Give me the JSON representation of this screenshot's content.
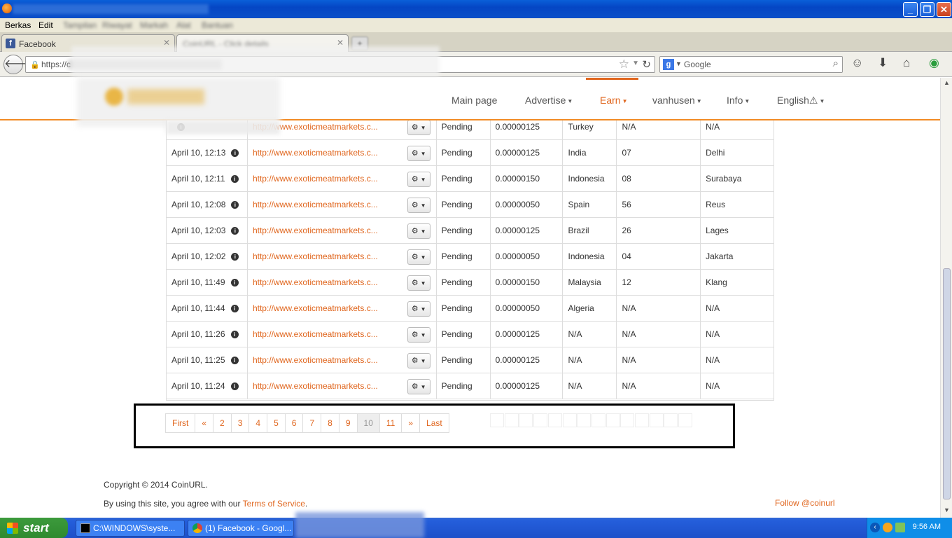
{
  "browser": {
    "menu": [
      "Berkas",
      "Edit",
      "Tampilan",
      "Riwayat",
      "Markah",
      "Alat",
      "Bantuan"
    ],
    "tabs": [
      {
        "label": "Facebook"
      },
      {
        "label": "CoinURL - Click details"
      }
    ],
    "url": "https://c",
    "search_engine": "Google",
    "search_placeholder": "Google"
  },
  "site": {
    "nav": [
      {
        "label": "Main page",
        "active": false
      },
      {
        "label": "Advertise",
        "active": false
      },
      {
        "label": "Earn",
        "active": true
      },
      {
        "label": "vanhusen",
        "active": false
      },
      {
        "label": "Info",
        "active": false
      },
      {
        "label": "English",
        "active": false
      }
    ],
    "accent_color": "#e0661e"
  },
  "table": {
    "rows": [
      {
        "date": "",
        "url": "http://www.exoticmeatmarkets.c...",
        "status": "Pending",
        "amount": "0.00000125",
        "country": "Turkey",
        "region": "N/A",
        "city": "N/A"
      },
      {
        "date": "April 10, 12:13",
        "url": "http://www.exoticmeatmarkets.c...",
        "status": "Pending",
        "amount": "0.00000125",
        "country": "India",
        "region": "07",
        "city": "Delhi"
      },
      {
        "date": "April 10, 12:11",
        "url": "http://www.exoticmeatmarkets.c...",
        "status": "Pending",
        "amount": "0.00000150",
        "country": "Indonesia",
        "region": "08",
        "city": "Surabaya"
      },
      {
        "date": "April 10, 12:08",
        "url": "http://www.exoticmeatmarkets.c...",
        "status": "Pending",
        "amount": "0.00000050",
        "country": "Spain",
        "region": "56",
        "city": "Reus"
      },
      {
        "date": "April 10, 12:03",
        "url": "http://www.exoticmeatmarkets.c...",
        "status": "Pending",
        "amount": "0.00000125",
        "country": "Brazil",
        "region": "26",
        "city": "Lages"
      },
      {
        "date": "April 10, 12:02",
        "url": "http://www.exoticmeatmarkets.c...",
        "status": "Pending",
        "amount": "0.00000050",
        "country": "Indonesia",
        "region": "04",
        "city": "Jakarta"
      },
      {
        "date": "April 10, 11:49",
        "url": "http://www.exoticmeatmarkets.c...",
        "status": "Pending",
        "amount": "0.00000150",
        "country": "Malaysia",
        "region": "12",
        "city": "Klang"
      },
      {
        "date": "April 10, 11:44",
        "url": "http://www.exoticmeatmarkets.c...",
        "status": "Pending",
        "amount": "0.00000050",
        "country": "Algeria",
        "region": "N/A",
        "city": "N/A"
      },
      {
        "date": "April 10, 11:26",
        "url": "http://www.exoticmeatmarkets.c...",
        "status": "Pending",
        "amount": "0.00000125",
        "country": "N/A",
        "region": "N/A",
        "city": "N/A"
      },
      {
        "date": "April 10, 11:25",
        "url": "http://www.exoticmeatmarkets.c...",
        "status": "Pending",
        "amount": "0.00000125",
        "country": "N/A",
        "region": "N/A",
        "city": "N/A"
      },
      {
        "date": "April 10, 11:24",
        "url": "http://www.exoticmeatmarkets.c...",
        "status": "Pending",
        "amount": "0.00000125",
        "country": "N/A",
        "region": "N/A",
        "city": "N/A"
      }
    ]
  },
  "pagination": {
    "items": [
      {
        "label": "First",
        "disabled": false
      },
      {
        "label": "«",
        "disabled": false
      },
      {
        "label": "2",
        "disabled": false
      },
      {
        "label": "3",
        "disabled": false
      },
      {
        "label": "4",
        "disabled": false
      },
      {
        "label": "5",
        "disabled": false
      },
      {
        "label": "6",
        "disabled": false
      },
      {
        "label": "7",
        "disabled": false
      },
      {
        "label": "8",
        "disabled": false
      },
      {
        "label": "9",
        "disabled": false
      },
      {
        "label": "10",
        "disabled": true
      },
      {
        "label": "11",
        "disabled": false
      },
      {
        "label": "»",
        "disabled": false
      },
      {
        "label": "Last",
        "disabled": false
      }
    ]
  },
  "footer": {
    "copyright": "Copyright © 2014 CoinURL.",
    "agree_text": "By using this site, you agree with our ",
    "terms_link": "Terms of Service",
    "terms_suffix": ".",
    "follow": "Follow @coinurl"
  },
  "taskbar": {
    "start": "start",
    "tasks": [
      {
        "label": "C:\\WINDOWS\\syste..."
      },
      {
        "label": "(1) Facebook - Googl..."
      }
    ],
    "clock": "9:56 AM"
  }
}
